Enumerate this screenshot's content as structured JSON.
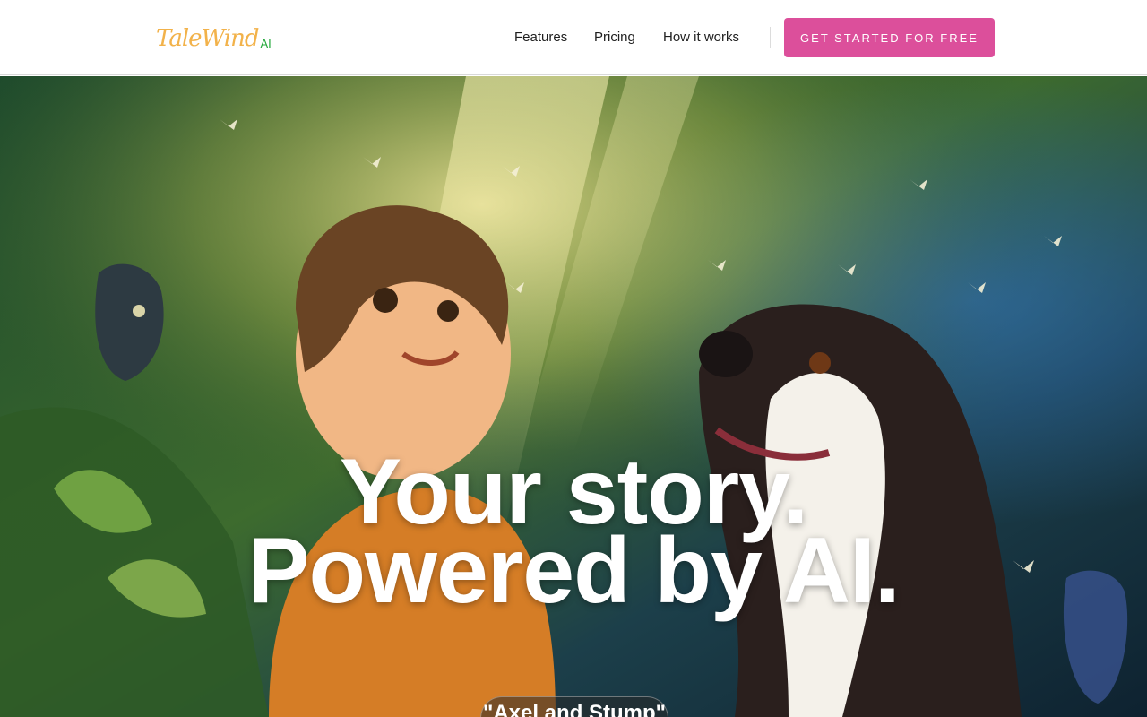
{
  "header": {
    "logo_script": "TaleWind",
    "logo_ai": "AI",
    "nav": [
      {
        "label": "Features"
      },
      {
        "label": "Pricing"
      },
      {
        "label": "How it works"
      }
    ],
    "cta_label": "GET STARTED FOR FREE"
  },
  "hero": {
    "headline_line1": "Your story.",
    "headline_line2": "Powered by AI.",
    "story_title": "\"Axel and Stump\"",
    "image_subject": "illustration-boy-and-dog-in-forest"
  },
  "colors": {
    "cta": "#dc4f9b",
    "logo_gold": "#f2b24a",
    "logo_green": "#22a83a"
  }
}
